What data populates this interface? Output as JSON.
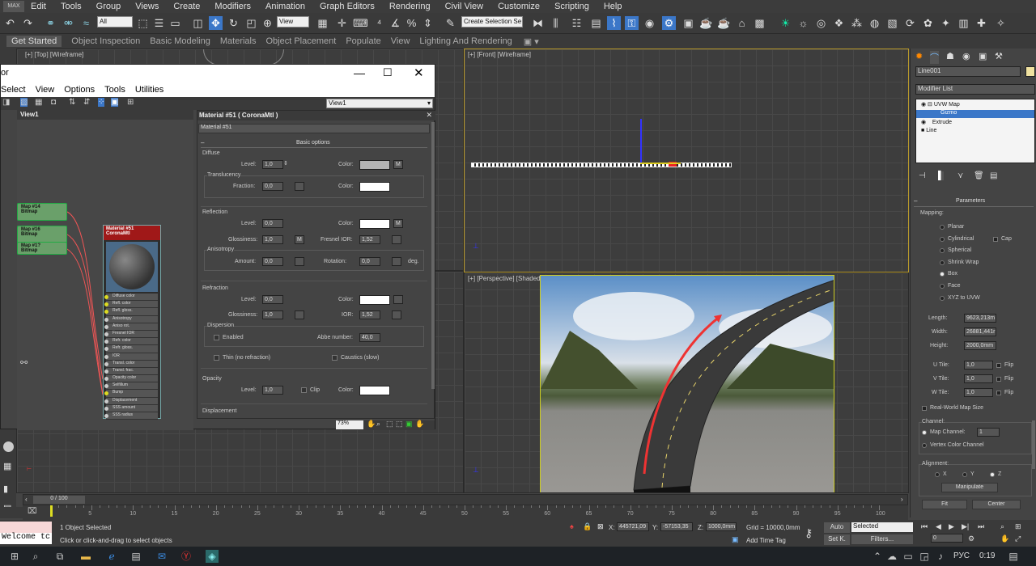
{
  "menu": [
    "Edit",
    "Tools",
    "Group",
    "Views",
    "Create",
    "Modifiers",
    "Animation",
    "Graph Editors",
    "Rendering",
    "Civil View",
    "Customize",
    "Scripting",
    "Help"
  ],
  "toolbar": {
    "filter_value": "All",
    "view_value": "View",
    "selection_set_value": "Create Selection Se"
  },
  "ribbon_tabs": [
    "Get Started",
    "Object Inspection",
    "Basic Modeling",
    "Materials",
    "Object Placement",
    "Populate",
    "View",
    "Lighting And Rendering"
  ],
  "viewports": {
    "top": "[+] [Top] [Wireframe]",
    "front": "[+] [Front] [Wireframe]",
    "perspective": "[+] [Perspective] [Shaded]"
  },
  "material_editor": {
    "title": "or",
    "menu": [
      "Select",
      "View",
      "Options",
      "Tools",
      "Utilities"
    ],
    "view_dropdown": "View1",
    "view_tab": "View1",
    "panel_title": "Material #51  ( CoronaMtl )",
    "material_name": "Material #51",
    "zoom": "73%",
    "nodes": [
      {
        "label": "Map #14\nBitmap"
      },
      {
        "label": "Map #16\nBitmap"
      },
      {
        "label": "Map #1?\nBitmap"
      }
    ],
    "mat_node_title": "Material #51\nCoronaMtl",
    "slots": [
      "Diffuse color",
      "Refl. color",
      "Refl. gloss.",
      "Anisotropy",
      "Aniso rot.",
      "Fresnel IOR",
      "Refr. color",
      "Refr. gloss.",
      "IOR",
      "Transl. color",
      "Transl. frac.",
      "Opacity color",
      "Selfillum",
      "Bump",
      "Displacement",
      "SSS amount",
      "SSS radius"
    ],
    "section_basic": "Basic options",
    "diffuse": {
      "title": "Diffuse",
      "level_label": "Level:",
      "level": "1,0",
      "color_label": "Color:",
      "m": "M"
    },
    "translucency": {
      "title": "Translucency",
      "fraction_label": "Fraction:",
      "fraction": "0,0",
      "color_label": "Color:"
    },
    "reflection": {
      "title": "Reflection",
      "level_label": "Level:",
      "level": "0,0",
      "color_label": "Color:",
      "m": "M",
      "gloss_label": "Glossiness:",
      "gloss": "1,0",
      "gm": "M",
      "ior_label": "Fresnel IOR:",
      "ior": "1,52"
    },
    "anisotropy": {
      "title": "Anisotropy",
      "amount_label": "Amount:",
      "amount": "0,0",
      "rotation_label": "Rotation:",
      "rotation": "0,0",
      "deg": "deg."
    },
    "refraction": {
      "title": "Refraction",
      "level_label": "Level:",
      "level": "0,0",
      "color_label": "Color:",
      "gloss_label": "Glossiness:",
      "gloss": "1,0",
      "ior_label": "IOR:",
      "ior": "1,52"
    },
    "dispersion": {
      "title": "Dispersion",
      "enabled": "Enabled",
      "abbe_label": "Abbe number:",
      "abbe": "40,0"
    },
    "thin": "Thin (no refraction)",
    "caustics": "Caustics (slow)",
    "opacity": {
      "title": "Opacity",
      "level_label": "Level:",
      "level": "1,0",
      "clip": "Clip",
      "color_label": "Color:"
    },
    "displacement": {
      "title": "Displacement"
    }
  },
  "command_panel": {
    "object_name": "Line001",
    "modifier_list": "Modifier List",
    "stack": [
      "UVW Map",
      "Gizmo",
      "Extrude",
      "Line"
    ],
    "params_title": "Parameters",
    "mapping_label": "Mapping:",
    "mapping": [
      "Planar",
      "Cylindrical",
      "Spherical",
      "Shrink Wrap",
      "Box",
      "Face",
      "XYZ to UVW"
    ],
    "mapping_selected": "Box",
    "cap": "Cap",
    "length_label": "Length:",
    "length": "9623,213m",
    "width_label": "Width:",
    "width": "26881,441r",
    "height_label": "Height:",
    "height": "2000,0mm",
    "utile_label": "U Tile:",
    "utile": "1,0",
    "vtile_label": "V Tile:",
    "vtile": "1,0",
    "wtile_label": "W Tile:",
    "wtile": "1,0",
    "flip": "Flip",
    "realworld": "Real-World Map Size",
    "channel_label": "Channel:",
    "map_channel": "Map Channel:",
    "map_channel_val": "1",
    "vertex_color": "Vertex Color Channel",
    "alignment_label": "Alignment:",
    "x": "X",
    "y": "Y",
    "z": "Z",
    "manipulate": "Manipulate",
    "fit": "Fit",
    "center": "Center"
  },
  "timeline": {
    "frame": "0 / 100",
    "ticks": [
      "5",
      "10",
      "15",
      "20",
      "25",
      "30",
      "35",
      "40",
      "45",
      "50",
      "55",
      "60",
      "65",
      "70",
      "75",
      "80",
      "85",
      "90",
      "95",
      "100"
    ]
  },
  "status": {
    "welcome": "Welcome tc",
    "selected": "1 Object Selected",
    "hint": "Click or click-and-drag to select objects",
    "x_label": "X:",
    "x": "445721,09",
    "y_label": "Y:",
    "y": "-57153,35",
    "z_label": "Z:",
    "z": "1000,0mm",
    "grid": "Grid = 10000,0mm",
    "add_time_tag": "Add Time Tag",
    "auto": "Auto",
    "setk": "Set K.",
    "selected_dd": "Selected",
    "filters": "Filters...",
    "frame_val": "0"
  },
  "taskbar": {
    "lang": "РУС",
    "time": "0:19"
  }
}
